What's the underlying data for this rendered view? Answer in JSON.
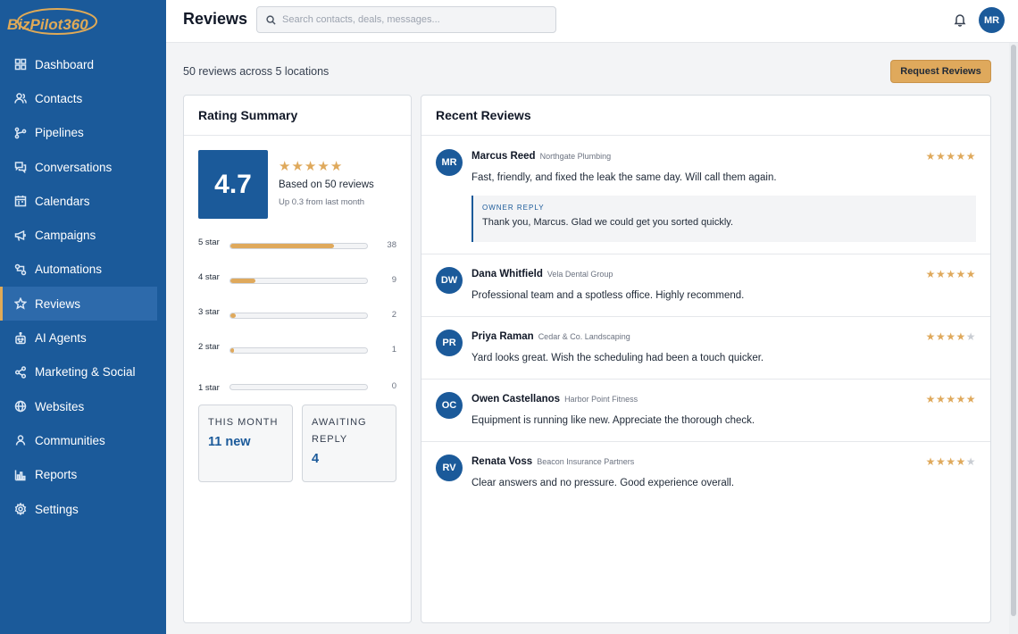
{
  "brand": {
    "logo_text": "BizPilot360",
    "accent": "#1b5a9a",
    "gold": "#dfa95c"
  },
  "sidebar": {
    "items": [
      {
        "label": "Dashboard",
        "icon": "dashboard-icon",
        "active": false
      },
      {
        "label": "Contacts",
        "icon": "contacts-icon",
        "active": false
      },
      {
        "label": "Pipelines",
        "icon": "pipelines-icon",
        "active": false
      },
      {
        "label": "Conversations",
        "icon": "conversations-icon",
        "active": false
      },
      {
        "label": "Calendars",
        "icon": "calendar-icon",
        "active": false
      },
      {
        "label": "Campaigns",
        "icon": "megaphone-icon",
        "active": false
      },
      {
        "label": "Automations",
        "icon": "automations-icon",
        "active": false
      },
      {
        "label": "Reviews",
        "icon": "star-icon",
        "active": true
      },
      {
        "label": "AI Agents",
        "icon": "robot-icon",
        "active": false
      },
      {
        "label": "Marketing & Social",
        "icon": "share-icon",
        "active": false
      },
      {
        "label": "Websites",
        "icon": "globe-icon",
        "active": false
      },
      {
        "label": "Communities",
        "icon": "communities-icon",
        "active": false
      },
      {
        "label": "Reports",
        "icon": "reports-icon",
        "active": false
      },
      {
        "label": "Settings",
        "icon": "gear-icon",
        "active": false
      }
    ]
  },
  "header": {
    "title": "Reviews",
    "search_placeholder": "Search contacts, deals, messages...",
    "user_initials": "MR"
  },
  "main": {
    "subtitle": "50 reviews across 5 locations",
    "request_button": "Request Reviews"
  },
  "summary": {
    "title": "Rating Summary",
    "score": "4.7",
    "score_stars": 5,
    "based_on": "Based on 50 reviews",
    "trend": "Up 0.3 from last month",
    "distribution": [
      {
        "label": "5 star",
        "count": "38",
        "fraction": 0.76
      },
      {
        "label": "4 star",
        "count": "9",
        "fraction": 0.18
      },
      {
        "label": "3 star",
        "count": "2",
        "fraction": 0.04
      },
      {
        "label": "2 star",
        "count": "1",
        "fraction": 0.02
      },
      {
        "label": "1 star",
        "count": "0",
        "fraction": 0.0
      }
    ],
    "this_month_label": "THIS MONTH",
    "this_month_value": "11 new",
    "awaiting_label": "AWAITING REPLY",
    "awaiting_value": "4"
  },
  "recent": {
    "title": "Recent Reviews",
    "reviews": [
      {
        "initials": "MR",
        "name": "Marcus Reed",
        "business": "Northgate Plumbing",
        "rating": 5,
        "text": "Fast, friendly, and fixed the leak the same day. Will call them again.",
        "owner_reply_label": "OWNER REPLY",
        "owner_reply": "Thank you, Marcus. Glad we could get you sorted quickly."
      },
      {
        "initials": "DW",
        "name": "Dana Whitfield",
        "business": "Vela Dental Group",
        "rating": 5,
        "text": "Professional team and a spotless office. Highly recommend."
      },
      {
        "initials": "PR",
        "name": "Priya Raman",
        "business": "Cedar & Co. Landscaping",
        "rating": 4,
        "text": "Yard looks great. Wish the scheduling had been a touch quicker."
      },
      {
        "initials": "OC",
        "name": "Owen Castellanos",
        "business": "Harbor Point Fitness",
        "rating": 5,
        "text": "Equipment is running like new. Appreciate the thorough check."
      },
      {
        "initials": "RV",
        "name": "Renata Voss",
        "business": "Beacon Insurance Partners",
        "rating": 4,
        "text": "Clear answers and no pressure. Good experience overall."
      }
    ]
  }
}
